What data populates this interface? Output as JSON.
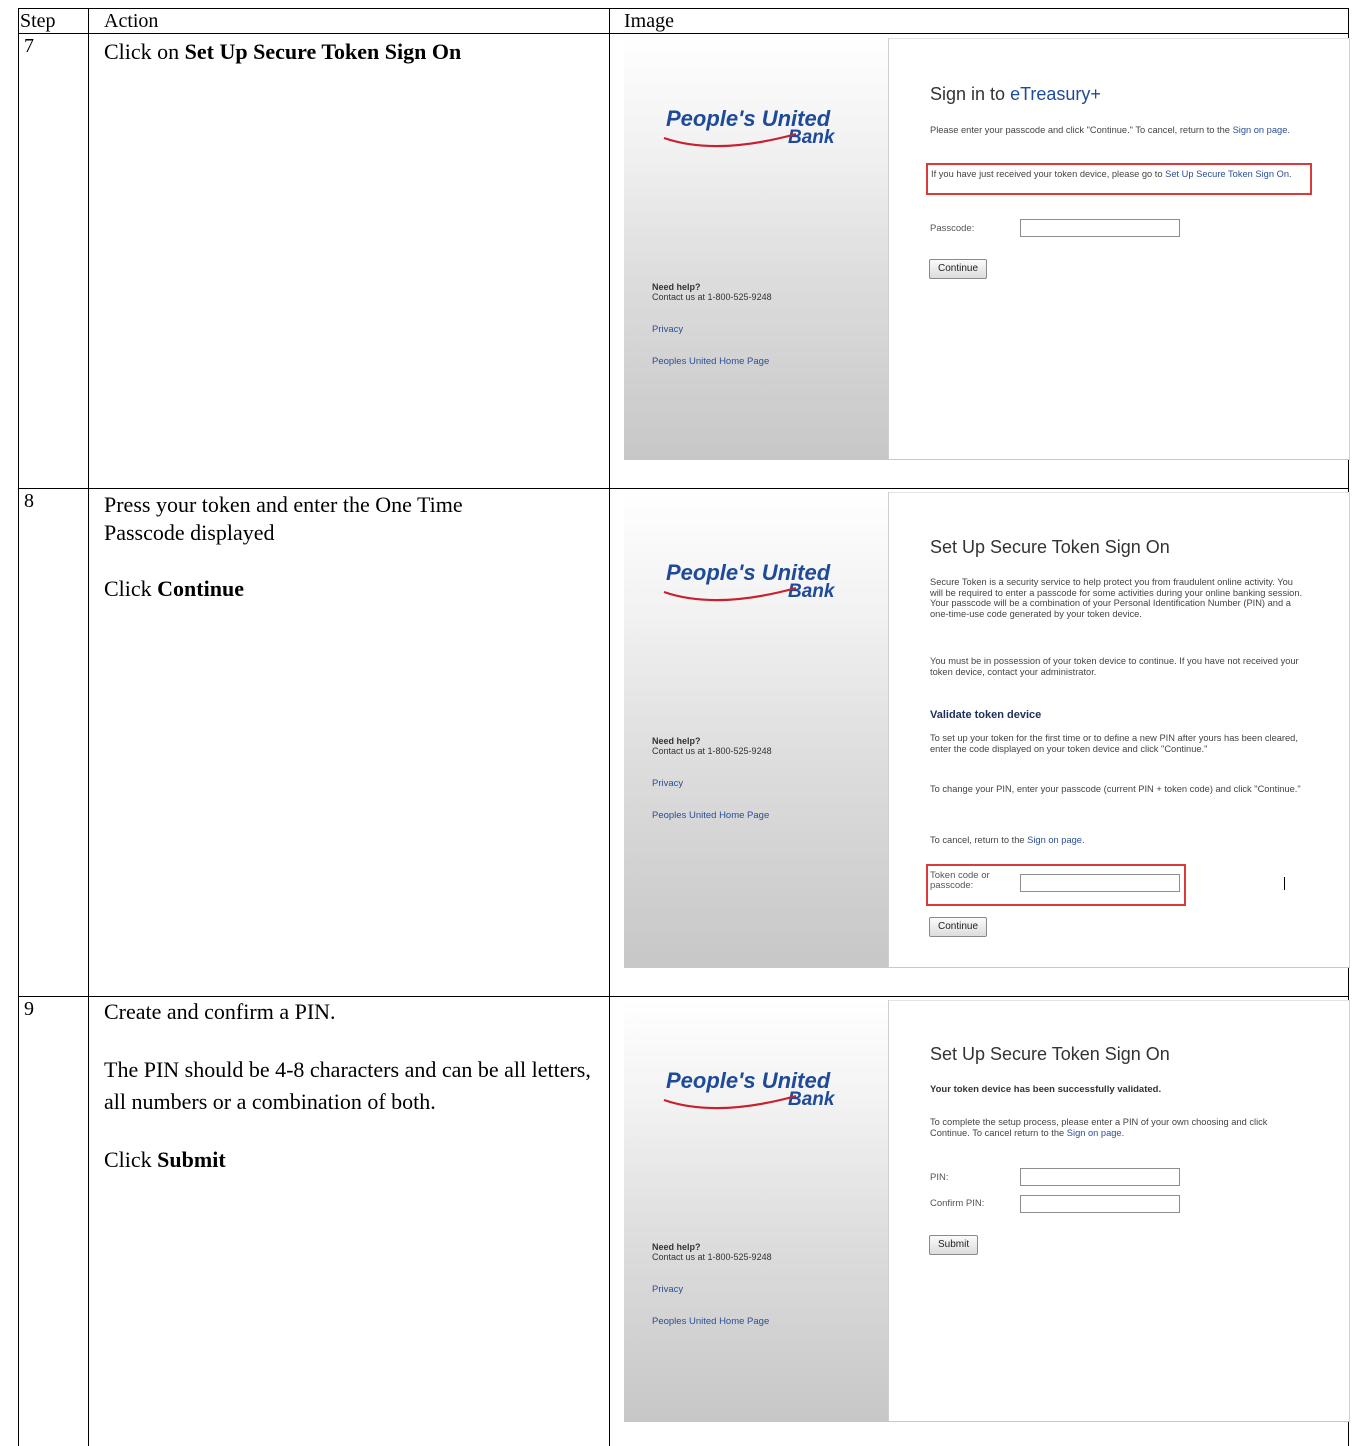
{
  "table": {
    "headers": [
      "Step",
      "Action",
      "Image"
    ]
  },
  "rows": [
    {
      "step": "7",
      "action_pre": "Click on ",
      "action_bold": "Set Up Secure Token Sign On"
    },
    {
      "step": "8",
      "action_line1": "Press your token and enter the One Time Passcode displayed",
      "action_pre": "Click ",
      "action_bold": "Continue"
    },
    {
      "step": "9",
      "action_line1": "Create and confirm a PIN.",
      "action_line2": "The PIN should be 4-8 characters and can be all letters, all numbers or a combination of both.",
      "action_pre": "Click ",
      "action_bold": "Submit"
    }
  ],
  "sidebar": {
    "logo_line1": "People's United",
    "logo_line2": "Bank",
    "help_title": "Need help?",
    "help_contact": "Contact us at 1-800-525-9248",
    "privacy": "Privacy",
    "home": "Peoples United Home Page"
  },
  "shot1": {
    "title_pre": "Sign in to ",
    "title_accent": "eTreasury+",
    "intro": "Please enter your passcode and click \"Continue.\" To cancel, return to the ",
    "intro_link": "Sign on page.",
    "notice": "If you have just received your token device, please go to ",
    "notice_link": "Set Up Secure Token Sign On.",
    "passcode_label": "Passcode:",
    "continue": "Continue"
  },
  "shot2": {
    "title": "Set Up Secure Token Sign On",
    "p1": "Secure Token is a security service to help protect you from fraudulent online activity. You will be required to enter a passcode for some activities during your online banking session. Your passcode will be a combination of your Personal Identification Number (PIN) and a one-time-use code generated by your token device.",
    "p2": "You must be in possession of your token device to continue. If you have not received your token device, contact your administrator.",
    "subtitle": "Validate token device",
    "p3": "To set up your token for the first time or to define a new PIN after yours has been cleared, enter the code displayed on your token device and click \"Continue.\"",
    "p4": "To change your PIN, enter your passcode (current PIN + token code) and click \"Continue.\"",
    "cancel_pre": "To cancel, return to the ",
    "cancel_link": "Sign on page.",
    "token_label": "Token code or passcode:",
    "continue": "Continue"
  },
  "shot3": {
    "title": "Set Up Secure Token Sign On",
    "validated": "Your token device has been successfully validated.",
    "p1": "To complete the setup process, please enter a PIN of your own choosing and click Continue. To cancel return to the ",
    "p1_link": "Sign on page.",
    "pin_label": "PIN:",
    "confirm_label": "Confirm PIN:",
    "submit": "Submit"
  },
  "colors": {
    "logo_blue": "#1f4a9a",
    "logo_red": "#c8202f",
    "highlight": "#d93a3a",
    "link": "#2a4f96"
  }
}
